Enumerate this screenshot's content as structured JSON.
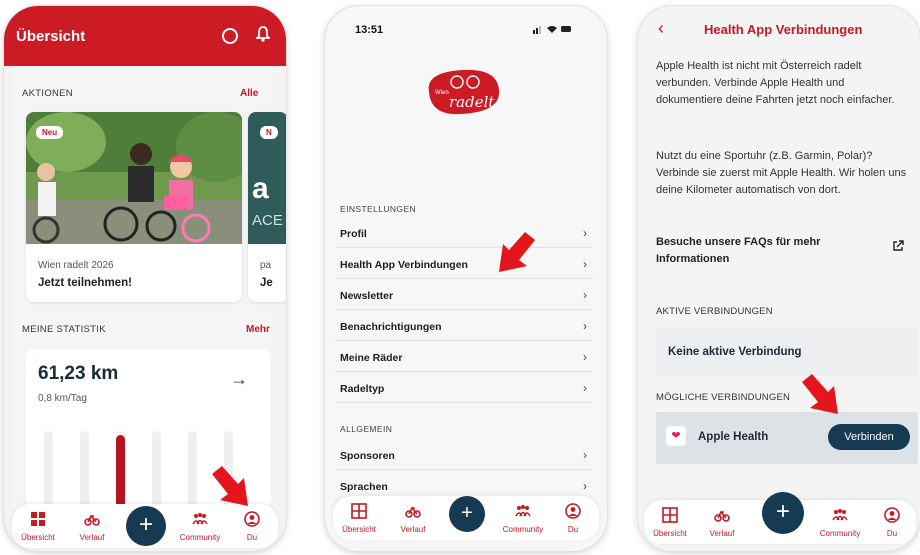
{
  "phone1": {
    "header_title": "Übersicht",
    "aktionen_label": "AKTIONEN",
    "aktionen_link": "Alle",
    "card1": {
      "badge": "Neu",
      "subtitle": "Wien radelt 2026",
      "title": "Jetzt teilnehmen!"
    },
    "card2": {
      "badge": "N",
      "subtitle": "pa",
      "title": "Je",
      "image_text": "a",
      "image_text2": "ACE"
    },
    "statistik_label": "MEINE STATISTIK",
    "statistik_link": "Mehr",
    "stat_value": "61,23 km",
    "stat_sub": "0,8 km/Tag",
    "stat_arrow": "→",
    "bar_levels": [
      0,
      0,
      0.95,
      0,
      0,
      0
    ]
  },
  "tabbar": {
    "tabs": [
      {
        "label": "Übersicht",
        "icon": "grid-icon"
      },
      {
        "label": "Verlauf",
        "icon": "bike-icon"
      },
      {
        "label": "Community",
        "icon": "people-icon"
      },
      {
        "label": "Du",
        "icon": "user-icon"
      }
    ],
    "fab": "+"
  },
  "phone2": {
    "status_time": "13:51",
    "logo_small": "Wien",
    "logo_text": "radelt",
    "section1": "EINSTELLUNGEN",
    "items1": [
      "Profil",
      "Health App Verbindungen",
      "Newsletter",
      "Benachrichtigungen",
      "Meine Räder",
      "Radeltyp"
    ],
    "section2": "ALLGEMEIN",
    "items2": [
      "Sponsoren",
      "Sprachen"
    ],
    "chevron": "›"
  },
  "phone3": {
    "back": "‹",
    "title": "Health App Verbindungen",
    "para1": "Apple Health ist nicht mit Österreich radelt verbunden. Verbinde Apple Health und dokumentiere deine Fahrten jetzt noch einfacher.",
    "para2": "Nutzt du eine Sportuhr (z.B. Garmin, Polar)? Verbinde sie zuerst mit Apple Health. Wir holen uns deine Kilometer automatisch von dort.",
    "faq": "Besuche unsere FAQs für mehr Informationen",
    "active_label": "AKTIVE VERBINDUNGEN",
    "active_none": "Keine aktive Verbindung",
    "possible_label": "MÖGLICHE VERBINDUNGEN",
    "apple_label": "Apple Health",
    "connect_btn": "Verbinden"
  },
  "colors": {
    "brand_red": "#cc1b24",
    "navy": "#163a52"
  }
}
